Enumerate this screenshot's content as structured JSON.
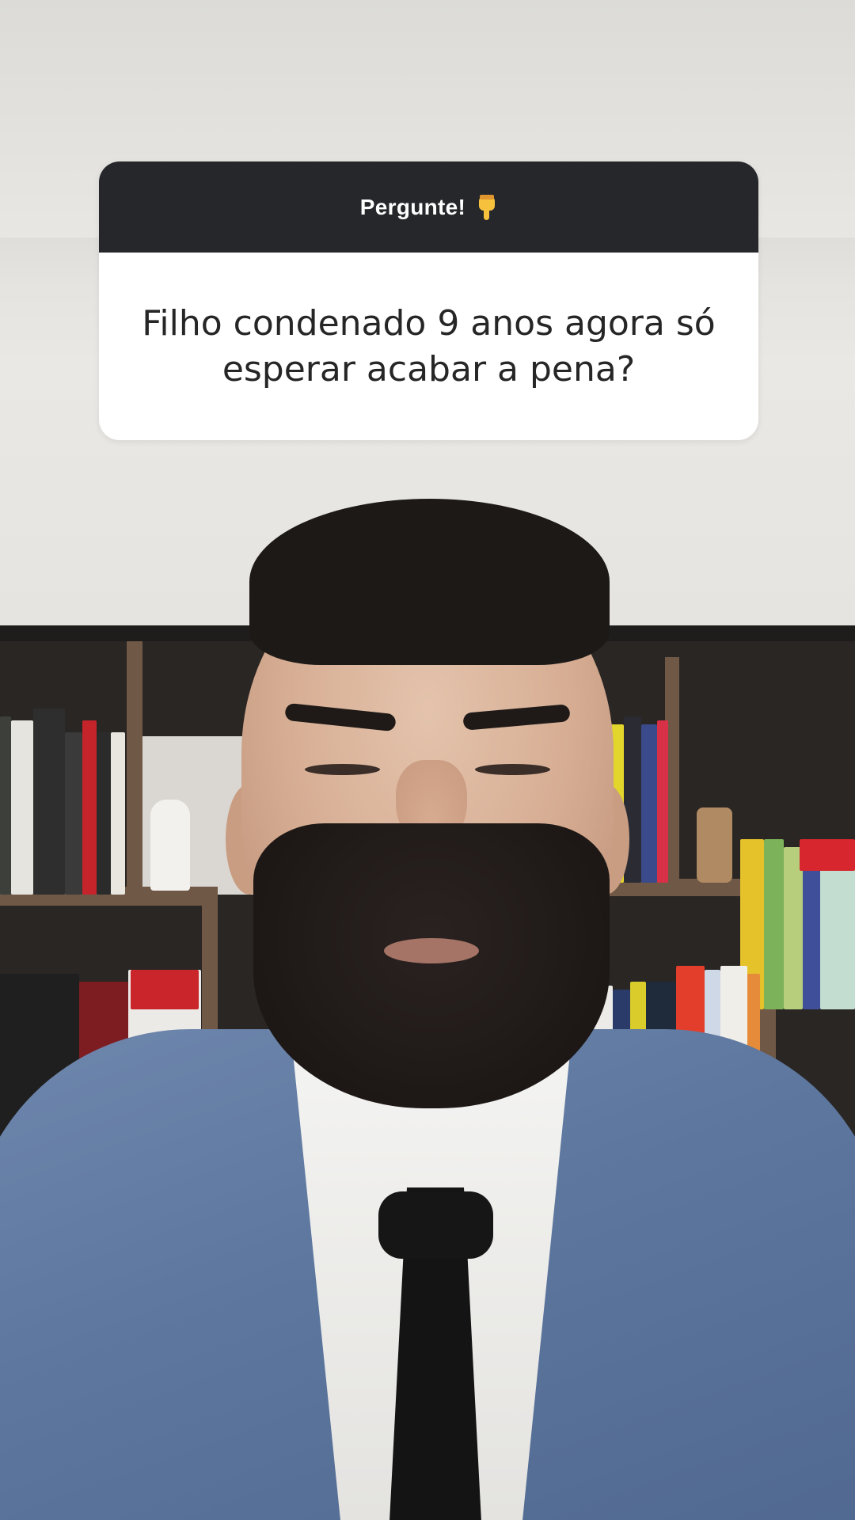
{
  "question_sticker": {
    "title": "Pergunte!",
    "title_icon": "pointing-down-icon",
    "question": "Filho condenado 9 anos agora só esperar acabar a pena?"
  },
  "colors": {
    "sticker_header": "#25272b",
    "sticker_body": "#ffffff",
    "question_text": "#262626",
    "jacket": "#5d779f"
  }
}
